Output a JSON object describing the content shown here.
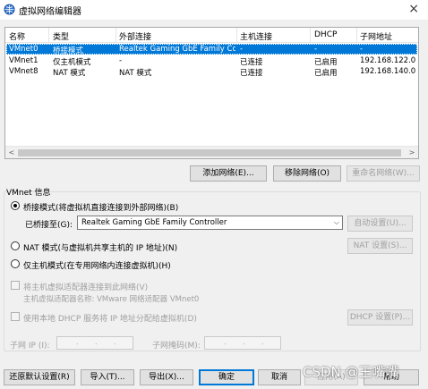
{
  "window": {
    "title": "虚拟网络编辑器",
    "close_label": "×"
  },
  "list": {
    "columns": [
      "名称",
      "类型",
      "外部连接",
      "主机连接",
      "DHCP",
      "子网地址"
    ],
    "rows": [
      [
        "VMnet0",
        "桥接模式",
        "Realtek Gaming GbE Family Co...",
        "-",
        "-",
        "-"
      ],
      [
        "VMnet1",
        "仅主机模式",
        "-",
        "已连接",
        "已启用",
        "192.168.122.0"
      ],
      [
        "VMnet8",
        "NAT 模式",
        "NAT 模式",
        "已连接",
        "已启用",
        "192.168.140.0"
      ]
    ],
    "selected_row": 0,
    "scroll_left": "<",
    "scroll_right": ">"
  },
  "list_buttons": {
    "add": "添加网络(E)...",
    "remove": "移除网络(O)",
    "rename": "重命名网络(W)..."
  },
  "vmnet_info": {
    "group_label": "VMnet 信息",
    "bridged_radio": "桥接模式(将虚拟机直接连接到外部网络)(B)",
    "bridged_to_label": "已桥接至(G):",
    "bridged_to_value": "Realtek Gaming GbE Family Controller",
    "auto_settings": "自动设置(U)...",
    "nat_radio": "NAT 模式(与虚拟机共享主机的 IP 地址)(N)",
    "nat_settings": "NAT 设置(S)...",
    "hostonly_radio": "仅主机模式(在专用网络内连接虚拟机)(H)",
    "connect_adapter": "将主机虚拟适配器连接到此网络(V)",
    "adapter_name": "主机虚拟适配器名称: VMware 网络适配器 VMnet0",
    "use_dhcp": "使用本地 DHCP 服务将 IP 地址分配给虚拟机(D)",
    "dhcp_settings": "DHCP 设置(P)...",
    "subnet_ip_label": "子网 IP (I):",
    "subnet_mask_label": "子网掩码(M):",
    "ip_dot": "."
  },
  "bottom_buttons": {
    "restore": "还原默认设置(R)",
    "import": "导入(T)...",
    "export": "导出(X)...",
    "ok": "确定",
    "cancel": "取消",
    "apply": "应用(A)",
    "help": "帮助"
  },
  "watermark": "CSDN @王嘴嘴",
  "colors": {
    "selection": "#0078d7",
    "disabled_text": "#a0a0a0",
    "button_face": "#e1e1e1"
  }
}
